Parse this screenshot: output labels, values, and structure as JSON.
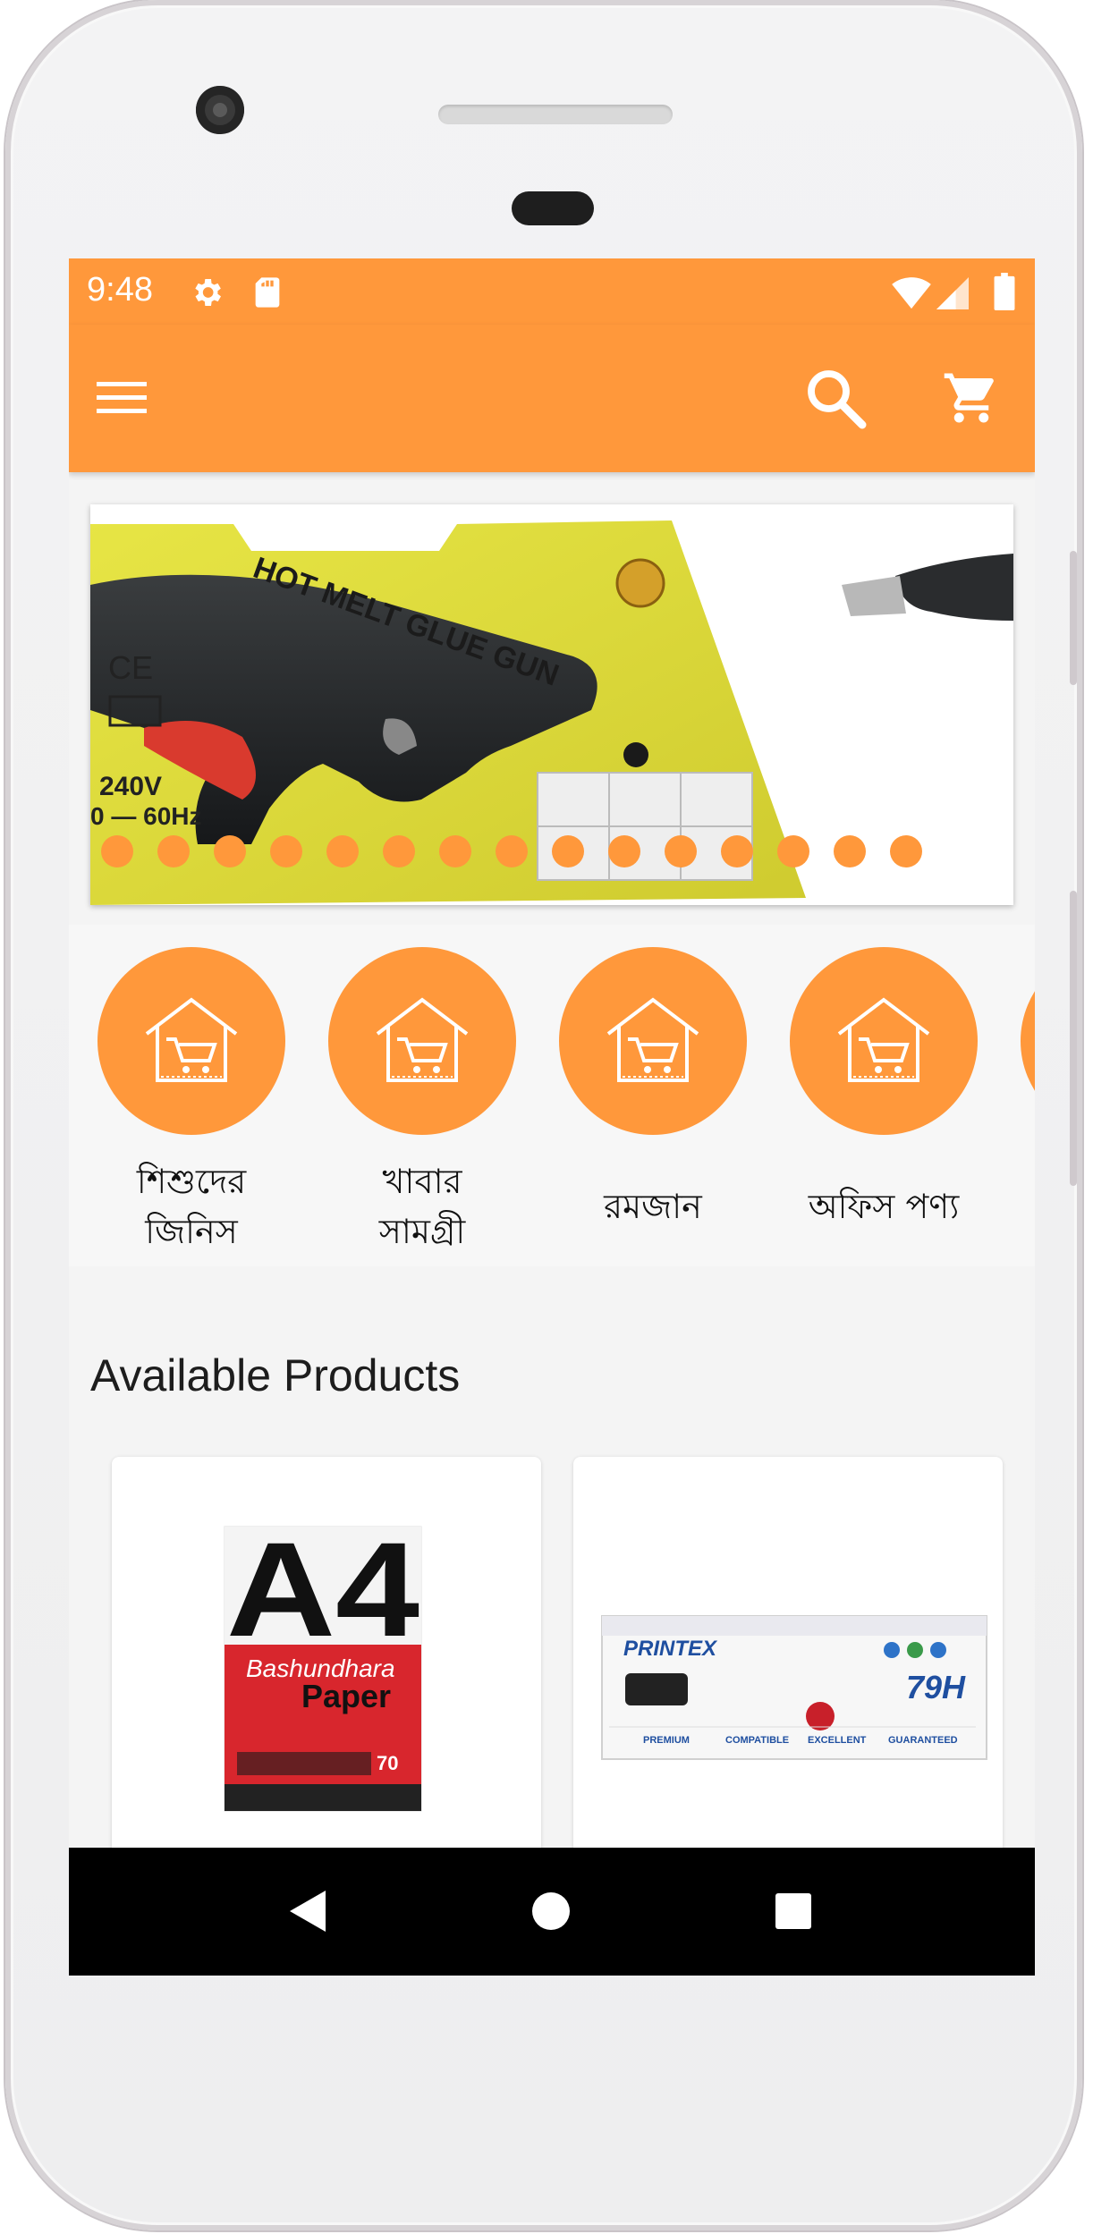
{
  "status_bar": {
    "time": "9:48",
    "icons": [
      "settings-gear-icon",
      "sd-card-icon",
      "wifi-icon",
      "signal-icon",
      "battery-icon"
    ]
  },
  "toolbar": {
    "menu_icon": "hamburger-menu-icon",
    "search_icon": "search-icon",
    "cart_icon": "shopping-cart-icon",
    "background": "#ff983b"
  },
  "banner": {
    "product_text": "HOT MELT GLUE GUN",
    "spec_text": "240V",
    "hz_text": "0 — 60Hz",
    "ce_mark": "CE",
    "dot_count": 15
  },
  "categories": [
    {
      "label": "শিশুদের জিনিস",
      "icon": "shop-house-cart-icon"
    },
    {
      "label": "খাবার সামগ্রী",
      "icon": "shop-house-cart-icon"
    },
    {
      "label": "রমজান",
      "icon": "shop-house-cart-icon"
    },
    {
      "label": "অফিস পণ্য",
      "icon": "shop-house-cart-icon"
    }
  ],
  "section": {
    "title": "Available Products"
  },
  "products": [
    {
      "brand_big": "A4",
      "brand_line1": "Bashundhara",
      "brand_line2": "Paper",
      "weight": "70"
    },
    {
      "brand": "PRINTEX",
      "model": "79H",
      "features": [
        "PREMIUM",
        "COMPATIBLE",
        "EXCELLENT",
        "GUARANTEED"
      ]
    }
  ],
  "nav": {
    "back": "back-icon",
    "home": "home-icon",
    "recents": "recents-icon"
  },
  "colors": {
    "accent": "#ff983b",
    "navbar": "#000000",
    "screen_bg": "#f4f4f4"
  }
}
